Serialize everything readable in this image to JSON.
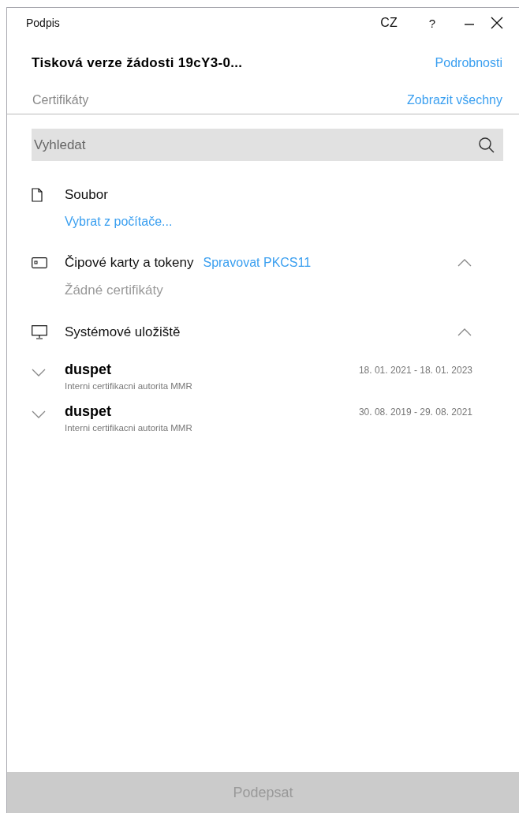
{
  "window": {
    "title": "Podpis",
    "language": "CZ",
    "help": "?"
  },
  "header": {
    "document_title": "Tisková verze žádosti 19cY3-0...",
    "details_link": "Podrobnosti"
  },
  "certificates_bar": {
    "label": "Certifikáty",
    "show_all_link": "Zobrazit všechny"
  },
  "search": {
    "placeholder": "Vyhledat"
  },
  "sections": [
    {
      "kind": "file",
      "title": "Soubor",
      "link": "Vybrat z počítače..."
    },
    {
      "kind": "card",
      "title": "Čipové karty a tokeny",
      "action_link": "Spravovat PKCS11",
      "expanded": true,
      "empty_text": "Žádné certifikáty"
    },
    {
      "kind": "system",
      "title": "Systémové uložiště",
      "expanded": true,
      "certificates": [
        {
          "name": "duspet",
          "issuer": "Interni certifikacni autorita MMR",
          "validity": "18. 01. 2021 - 18. 01. 2023",
          "expanded": false
        },
        {
          "name": "duspet",
          "issuer": "Interni certifikacni autorita MMR",
          "validity": "30. 08. 2019 - 29. 08. 2021",
          "expanded": false
        }
      ]
    }
  ],
  "sign_button": {
    "label": "Podepsat",
    "disabled": true
  }
}
